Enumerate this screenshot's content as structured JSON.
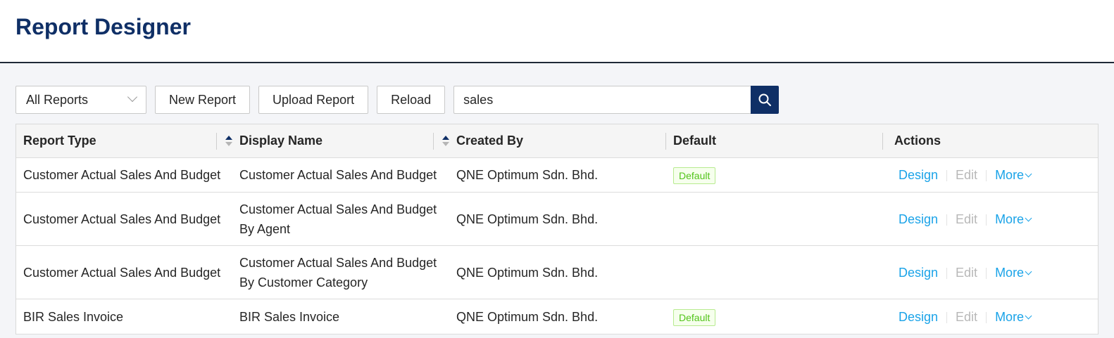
{
  "page": {
    "title": "Report Designer"
  },
  "toolbar": {
    "filter_selected": "All Reports",
    "new_report_label": "New Report",
    "upload_report_label": "Upload Report",
    "reload_label": "Reload",
    "search_value": "sales"
  },
  "table": {
    "columns": [
      "Report Type",
      "Display Name",
      "Created By",
      "Default",
      "Actions"
    ],
    "rows": [
      {
        "report_type": "Customer Actual Sales And Budget",
        "display_name": "Customer Actual Sales And Budget",
        "created_by": "QNE Optimum Sdn. Bhd.",
        "default": "Default"
      },
      {
        "report_type": "Customer Actual Sales And Budget",
        "display_name": "Customer Actual Sales And Budget By Agent",
        "created_by": "QNE Optimum Sdn. Bhd.",
        "default": ""
      },
      {
        "report_type": "Customer Actual Sales And Budget",
        "display_name": "Customer Actual Sales And Budget By Customer Category",
        "created_by": "QNE Optimum Sdn. Bhd.",
        "default": ""
      },
      {
        "report_type": "BIR Sales Invoice",
        "display_name": "BIR Sales Invoice",
        "created_by": "QNE Optimum Sdn. Bhd.",
        "default": "Default"
      }
    ],
    "actions": {
      "design": "Design",
      "edit": "Edit",
      "more": "More"
    }
  },
  "colors": {
    "brand_navy": "#0f2f66",
    "link_blue": "#1aa3e8",
    "default_tag_green": "#52c41a"
  },
  "icons": {
    "search_button": "search-icon",
    "filter_dropdown": "chevron-down-icon",
    "more": "chevron-down-icon"
  }
}
